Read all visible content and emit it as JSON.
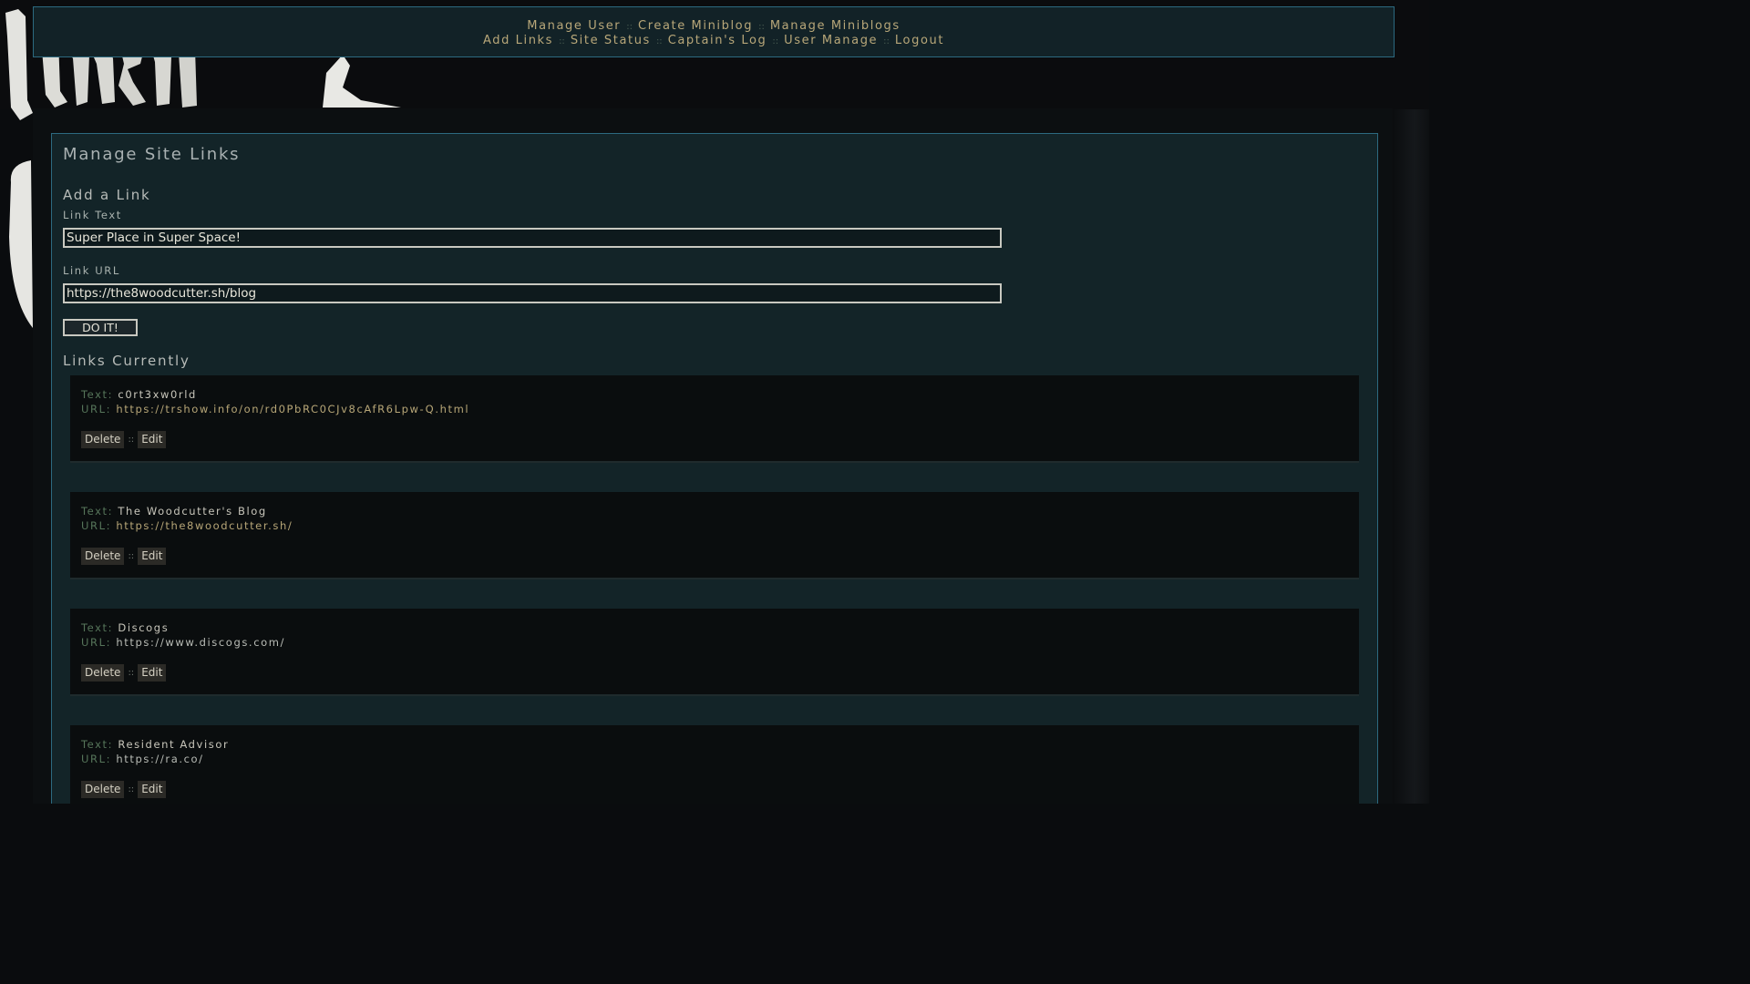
{
  "nav": {
    "row1": [
      {
        "label": "Manage User"
      },
      {
        "label": "Create Miniblog"
      },
      {
        "label": "Manage Miniblogs"
      }
    ],
    "row2": [
      {
        "label": "Add Links"
      },
      {
        "label": "Site Status"
      },
      {
        "label": "Captain's Log"
      },
      {
        "label": "User Manage"
      },
      {
        "label": "Logout"
      }
    ],
    "separator": "::"
  },
  "main": {
    "title": "Manage Site Links",
    "add_section": {
      "heading": "Add a Link",
      "link_text_label": "Link Text",
      "link_text_value": "Super Place in Super Space!",
      "link_url_label": "Link URL",
      "link_url_value": "https://the8woodcutter.sh/blog",
      "submit_label": "DO IT!"
    },
    "current_section": {
      "heading": "Links Currently",
      "text_key": "Text:",
      "url_key": "URL:",
      "delete_label": "Delete",
      "edit_label": "Edit",
      "action_separator": "::",
      "links": [
        {
          "text": "c0rt3xw0rld",
          "url": "https://trshow.info/on/rd0PbRC0CJv8cAfR6Lpw-Q.html"
        },
        {
          "text": "The Woodcutter's Blog",
          "url": "https://the8woodcutter.sh/"
        },
        {
          "text": "Discogs",
          "url": "https://www.discogs.com/"
        },
        {
          "text": "Resident Advisor",
          "url": "https://ra.co/"
        }
      ]
    }
  },
  "colors": {
    "panel_bg": "#132428",
    "border": "#2c6a80",
    "nav_link": "#b8a779",
    "label_green": "#56755a"
  }
}
